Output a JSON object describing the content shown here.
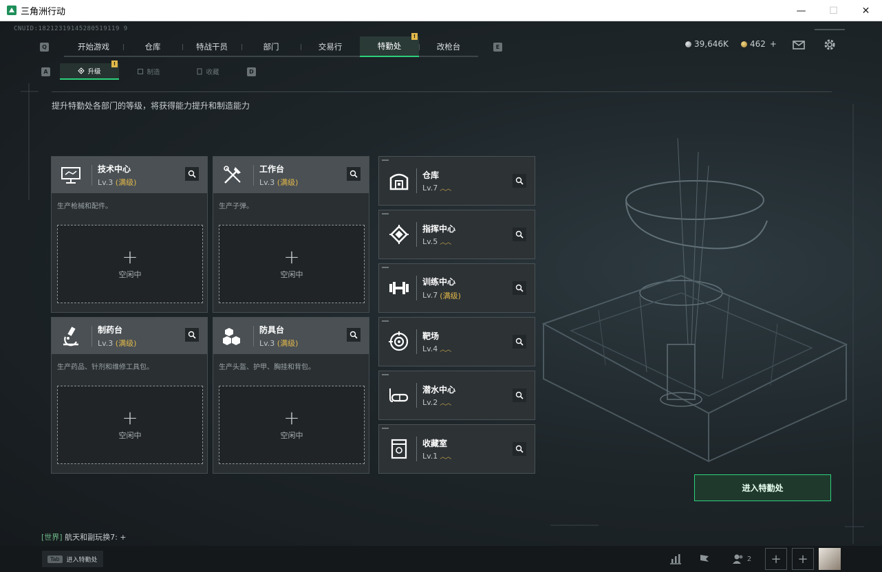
{
  "window": {
    "title": "三角洲行动",
    "minimize": "—",
    "maximize": "☐",
    "close": "✕"
  },
  "uid": "CNUID:18212319145280519119 9",
  "topnav": {
    "key_left": "Q",
    "key_right": "E",
    "tabs": [
      {
        "label": "开始游戏"
      },
      {
        "label": "仓库"
      },
      {
        "label": "特战干员"
      },
      {
        "label": "部门"
      },
      {
        "label": "交易行"
      },
      {
        "label": "特勤处",
        "active": true,
        "badge": "!"
      },
      {
        "label": "改枪台"
      }
    ]
  },
  "currency": {
    "silver": "39,646K",
    "gold": "462",
    "gold_add": "+"
  },
  "subnav": {
    "key_left": "A",
    "key_right": "D",
    "tabs": [
      {
        "label": "升级",
        "active": true,
        "badge": "!"
      },
      {
        "label": "制造"
      },
      {
        "label": "收藏"
      }
    ]
  },
  "description": "提升特勤处各部门的等级，将获得能力提升和制造能力",
  "production": [
    {
      "name": "技术中心",
      "level": "Lv.3",
      "max": "(满级)",
      "desc": "生产枪械和配件。",
      "slot_plus": "+",
      "slot_status": "空闲中",
      "icon": "computer-icon"
    },
    {
      "name": "工作台",
      "level": "Lv.3",
      "max": "(满级)",
      "desc": "生产子弹。",
      "slot_plus": "+",
      "slot_status": "空闲中",
      "icon": "tools-icon"
    },
    {
      "name": "制药台",
      "level": "Lv.3",
      "max": "(满级)",
      "desc": "生产药品、针剂和维修工具包。",
      "slot_plus": "+",
      "slot_status": "空闲中",
      "icon": "microscope-icon"
    },
    {
      "name": "防具台",
      "level": "Lv.3",
      "max": "(满级)",
      "desc": "生产头盔、护甲、胸挂和背包。",
      "slot_plus": "+",
      "slot_status": "空闲中",
      "icon": "cubes-icon"
    }
  ],
  "facilities": [
    {
      "name": "仓库",
      "level": "Lv.7",
      "upgradable": "︿︿"
    },
    {
      "name": "指挥中心",
      "level": "Lv.5",
      "upgradable": "︿︿"
    },
    {
      "name": "训练中心",
      "level": "Lv.7",
      "max": "(满级)"
    },
    {
      "name": "靶场",
      "level": "Lv.4",
      "upgradable": "︿︿"
    },
    {
      "name": "潜水中心",
      "level": "Lv.2",
      "upgradable": "︿︿"
    },
    {
      "name": "收藏室",
      "level": "Lv.1",
      "upgradable": "︿︿"
    }
  ],
  "enter_button": "进入特勤处",
  "chat": {
    "channel": "[世界]",
    "message": " 航天和副玩换7: +"
  },
  "bottom": {
    "tab_key": "Tab",
    "tab_label": "进入特勤处",
    "friends_count": "2",
    "add1": "+",
    "add2": "+"
  },
  "colors": {
    "accent": "#2dd27c",
    "max_level": "#e1b84a",
    "badge": "#e1b84a"
  }
}
